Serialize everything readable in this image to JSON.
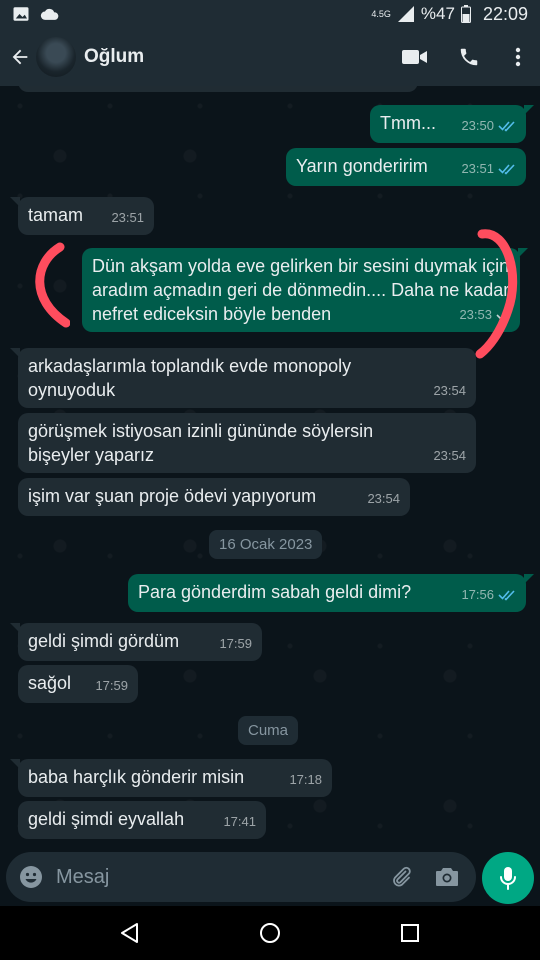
{
  "status_bar": {
    "network": "4.5G",
    "battery": "%47",
    "time": "22:09"
  },
  "header": {
    "contact_name": "Oğlum",
    "icons": [
      "back-arrow-icon",
      "video-call-icon",
      "voice-call-icon",
      "more-vert-icon"
    ]
  },
  "messages": [
    {
      "type": "out",
      "text": "Tmm...",
      "time": "23:50",
      "status": "read"
    },
    {
      "type": "out",
      "text": "Yarın gonderirim",
      "time": "23:51",
      "status": "read"
    },
    {
      "type": "in",
      "text": "tamam",
      "time": "23:51"
    },
    {
      "type": "out",
      "text": "Dün akşam yolda eve gelirken bir sesini duymak için aradım açmadın geri de dönmedin.... Daha ne kadar nefret ediceksin böyle benden",
      "time": "23:53",
      "status": "sent"
    },
    {
      "type": "in",
      "text": "arkadaşlarımla toplandık evde monopoly oynuyoduk",
      "time": "23:54"
    },
    {
      "type": "in",
      "text": "görüşmek istiyosan izinli gününde söylersin bişeyler yaparız",
      "time": "23:54"
    },
    {
      "type": "in",
      "text": "işim var şuan proje ödevi yapıyorum",
      "time": "23:54"
    },
    {
      "type": "date",
      "text": "16 Ocak 2023"
    },
    {
      "type": "out",
      "text": "Para gönderdim sabah geldi dimi?",
      "time": "17:56",
      "status": "read"
    },
    {
      "type": "in",
      "text": "geldi şimdi gördüm",
      "time": "17:59"
    },
    {
      "type": "in",
      "text": "sağol",
      "time": "17:59"
    },
    {
      "type": "date",
      "text": "Cuma"
    },
    {
      "type": "in",
      "text": "baba harçlık gönderir misin",
      "time": "17:18"
    },
    {
      "type": "in",
      "text": "geldi şimdi eyvallah",
      "time": "17:41"
    }
  ],
  "input": {
    "placeholder": "Mesaj",
    "icons": [
      "emoji-icon",
      "attach-icon",
      "camera-icon",
      "mic-icon"
    ]
  },
  "colors": {
    "incoming_bubble": "#202c33",
    "outgoing_bubble": "#005c4b",
    "read_tick": "#53bdeb",
    "accent": "#00a884",
    "annotation": "#ff4d5e"
  }
}
